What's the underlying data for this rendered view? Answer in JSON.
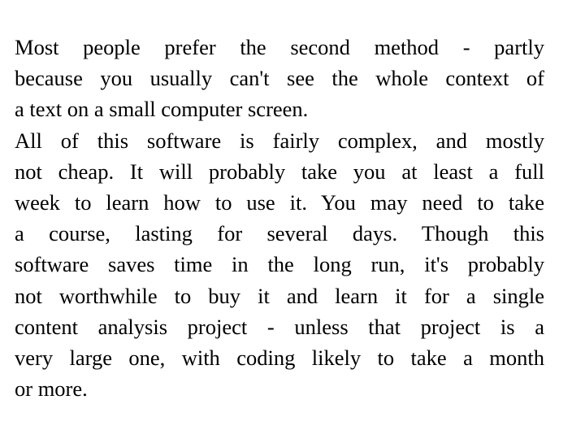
{
  "document": {
    "paragraphs": [
      {
        "lines": [
          "Most people prefer the second method - partly",
          "because you usually can't see the whole context of",
          "a text on a small computer screen."
        ]
      },
      {
        "lines": [
          "All of this software is fairly complex, and mostly",
          "not cheap. It will probably take you at least a full",
          "week to learn how to use it. You may need to take",
          "a course, lasting for several days. Though this",
          "software saves time in the long run, it's probably",
          "not worthwhile to buy it and learn it for a single",
          "content analysis project - unless that project is a",
          "very large one, with coding likely to take a month",
          "or more."
        ]
      }
    ]
  }
}
